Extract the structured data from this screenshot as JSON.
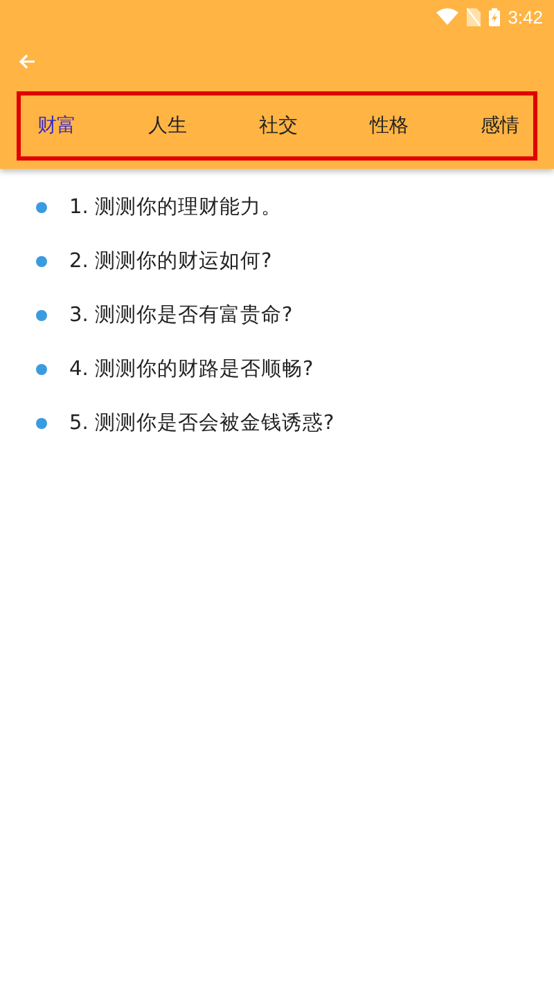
{
  "status_bar": {
    "time": "3:42"
  },
  "tabs": [
    {
      "label": "财富",
      "selected": true
    },
    {
      "label": "人生",
      "selected": false
    },
    {
      "label": "社交",
      "selected": false
    },
    {
      "label": "性格",
      "selected": false
    },
    {
      "label": "感情",
      "selected": false
    }
  ],
  "highlight_frame": {
    "on": true
  },
  "questions": [
    "1. 测测你的理财能力。",
    "2. 测测你的财运如何?",
    "3. 测测你是否有富贵命?",
    "4. 测测你的财路是否顺畅?",
    "5. 测测你是否会被金钱诱惑?"
  ]
}
